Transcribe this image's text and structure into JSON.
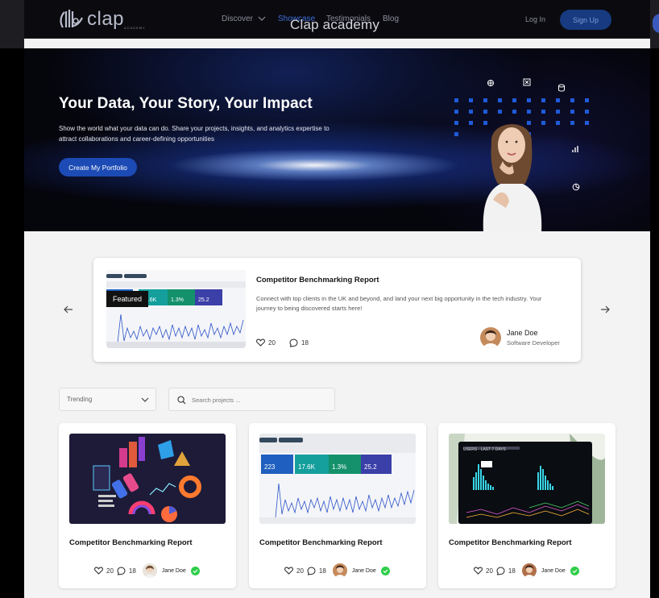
{
  "window_title": "Clap academy",
  "brand": {
    "name": "clap",
    "sub": "ACADEMY"
  },
  "nav": {
    "links": [
      "Discover",
      "Showcase",
      "Testimonials",
      "Blog"
    ],
    "login": "Log In",
    "signup": "Sign Up"
  },
  "hero": {
    "title": "Your Data, Your Story, Your Impact",
    "subtitle": "Show the world what your data can do. Share your projects, insights, and analytics expertise to attract collaborations and career-defining opportunities",
    "cta": "Create My Portfolio"
  },
  "featured": {
    "badge": "Featured",
    "title": "Competitor Benchmarking Report",
    "description": "Connect with top clients in the UK and beyond, and land your next big opportunity in the tech industry. Your journey to being discovered starts here!",
    "likes": "20",
    "comments": "18",
    "author": "Jane Doe",
    "role": "Software Developer"
  },
  "filters": {
    "sort": "Trending",
    "search_placeholder": "Search projects ..."
  },
  "cards": [
    {
      "title": "Competitor Benchmarking Report",
      "likes": "20",
      "comments": "18",
      "author": "Jane Doe"
    },
    {
      "title": "Competitor Benchmarking Report",
      "likes": "20",
      "comments": "18",
      "author": "Jane Doe"
    },
    {
      "title": "Competitor Benchmarking Report",
      "likes": "20",
      "comments": "18",
      "author": "Jane Doe"
    }
  ],
  "dashboard_thumb": {
    "tiles": [
      "223",
      "17.6K",
      "1.3%",
      "25.2"
    ],
    "tile_colors": [
      "#1f5fbf",
      "#149f9d",
      "#14916b",
      "#3b3fa8"
    ]
  },
  "icons": [
    "heart-icon",
    "comment-icon",
    "search-icon",
    "chevron-down-icon",
    "arrow-left-icon",
    "arrow-right-icon",
    "verified-icon"
  ],
  "colors": {
    "accent": "#1c4bb5",
    "verified": "#2fce4a",
    "nav_bg": "#0b0b0f"
  }
}
